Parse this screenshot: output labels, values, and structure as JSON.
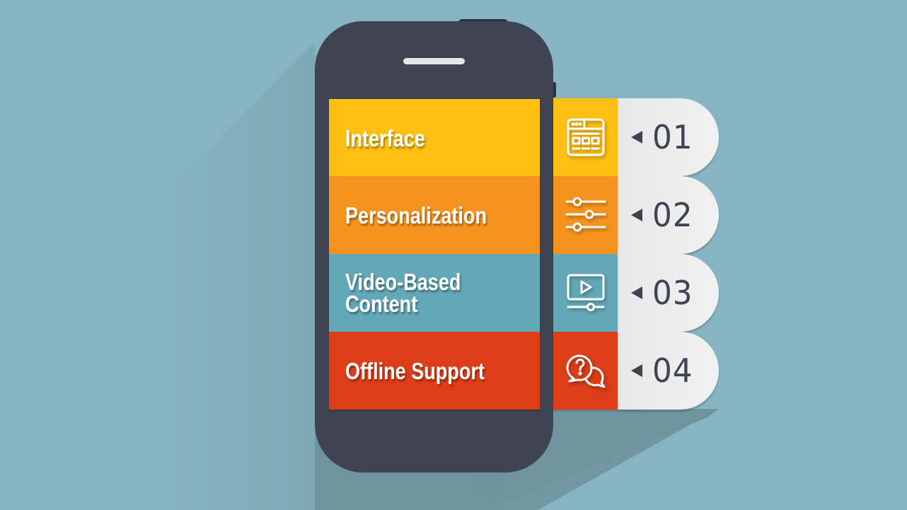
{
  "colors": {
    "background": "#87b4c2",
    "phone_body": "#3e4452",
    "pill": "#efefef",
    "text_dark": "#3e4452"
  },
  "items": [
    {
      "number": "01",
      "label": "Interface",
      "icon": "browser-window-icon",
      "color": "#fdc013"
    },
    {
      "number": "02",
      "label": "Personalization",
      "icon": "sliders-icon",
      "color": "#f6921e"
    },
    {
      "number": "03",
      "label": "Video-Based\nContent",
      "icon": "video-player-icon",
      "color": "#63a8b8"
    },
    {
      "number": "04",
      "label": "Offline Support",
      "icon": "question-chat-icon",
      "color": "#dd3e17"
    }
  ]
}
